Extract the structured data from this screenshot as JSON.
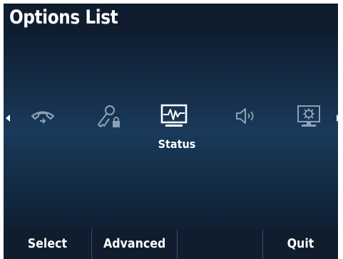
{
  "header": {
    "title": "Options List"
  },
  "carousel": {
    "items": [
      {
        "icon": "phone-forward-icon",
        "selected": false
      },
      {
        "icon": "key-lock-icon",
        "selected": false
      },
      {
        "icon": "status-waveform-icon",
        "selected": true,
        "label": "Status"
      },
      {
        "icon": "speaker-volume-icon",
        "selected": false
      },
      {
        "icon": "monitor-settings-icon",
        "selected": false
      }
    ],
    "selected_label": "Status"
  },
  "softkeys": {
    "key1": "Select",
    "key2": "Advanced",
    "key3": "",
    "key4": "Quit"
  },
  "colors": {
    "background": "#16314d",
    "bar": "#0f1d2e",
    "dim_icon": "#8ea0b8",
    "active_icon": "#ffffff",
    "text": "#ffffff"
  }
}
